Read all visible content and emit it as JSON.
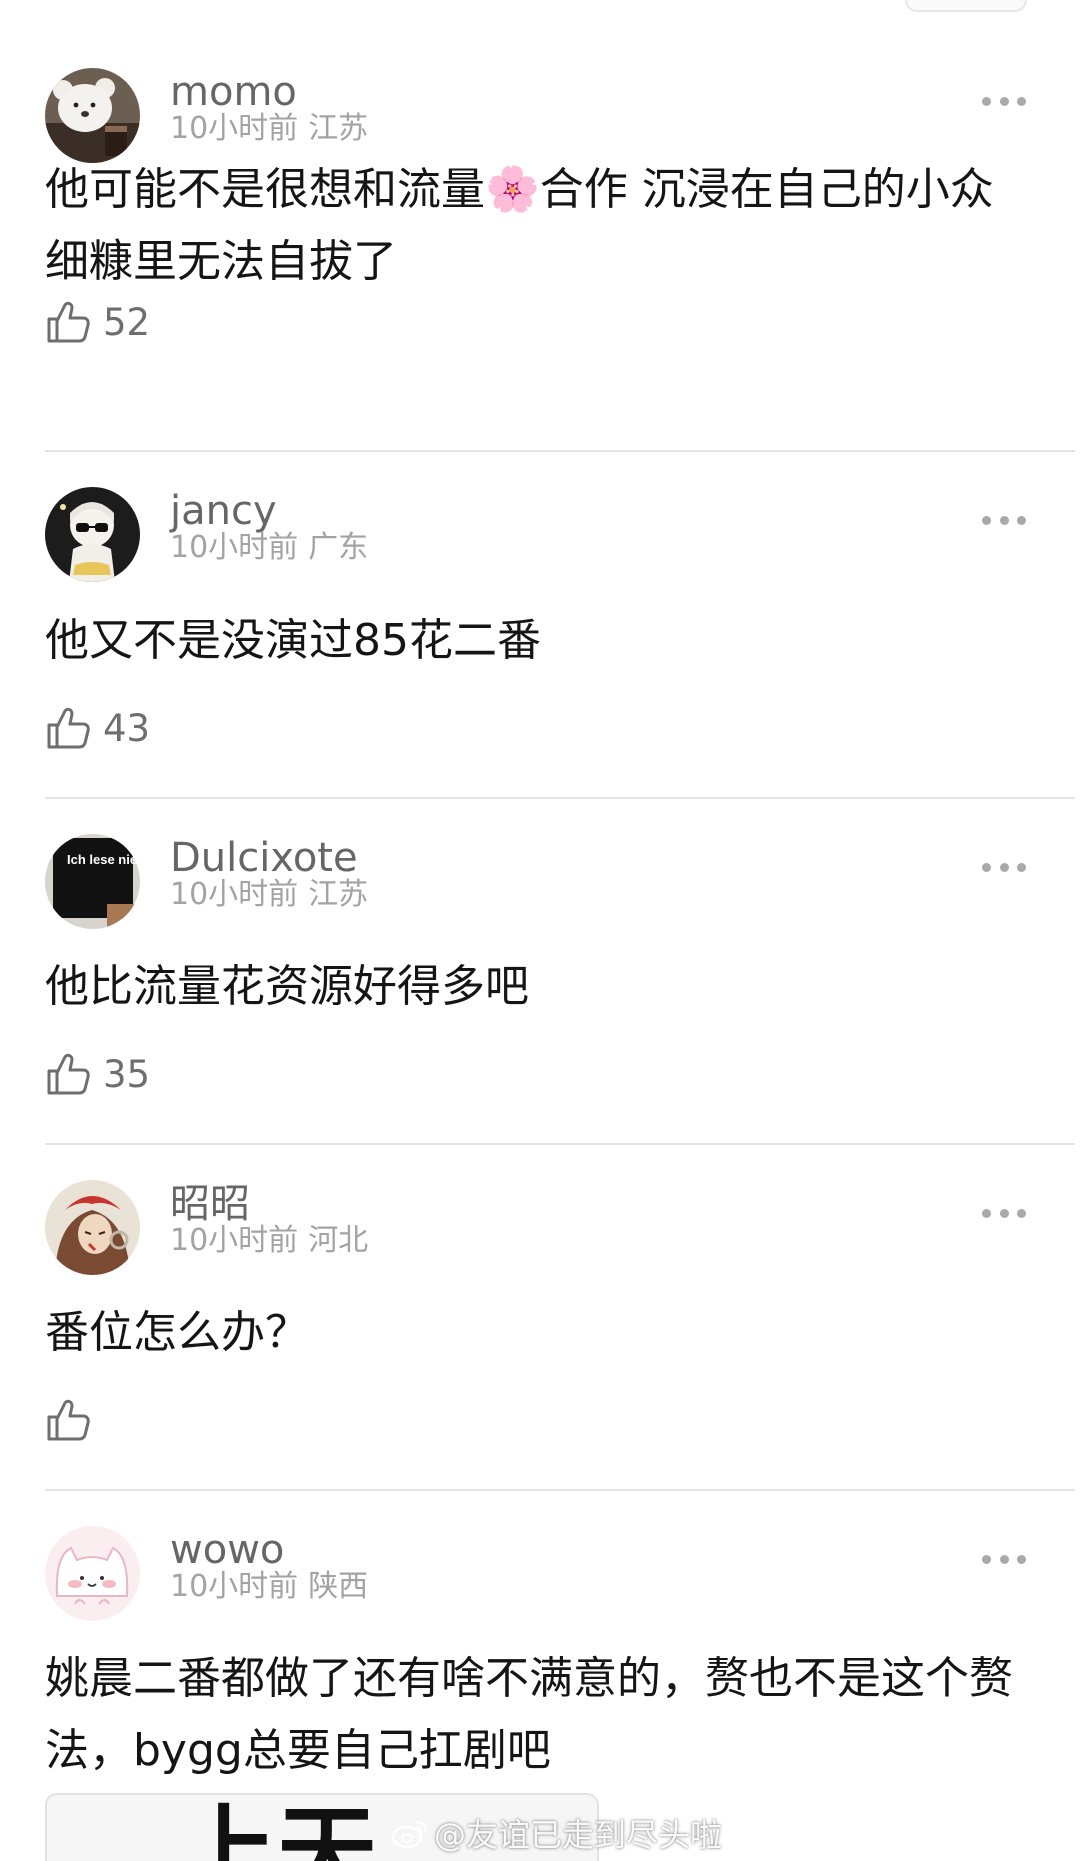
{
  "comments": [
    {
      "username": "momo",
      "time": "10小时前",
      "location": "江苏",
      "text": "他可能不是很想和流量🌸合作 沉浸在自己的小众细糠里无法自拔了",
      "likes": "52",
      "avatar": "white-bear-avatar"
    },
    {
      "username": "jancy",
      "time": "10小时前",
      "location": "广东",
      "text": "他又不是没演过85花二番",
      "likes": "43",
      "avatar": "anime-girl-sunglasses-avatar"
    },
    {
      "username": "Dulcixote",
      "time": "10小时前",
      "location": "江苏",
      "text": "他比流量花资源好得多吧",
      "likes": "35",
      "avatar": "book-cover-avatar",
      "avatar_text": "Ich lese nie.*"
    },
    {
      "username": "昭昭",
      "time": "10小时前",
      "location": "河北",
      "text": "番位怎么办？",
      "likes": "",
      "avatar": "anime-warrior-avatar"
    },
    {
      "username": "wowo",
      "time": "10小时前",
      "location": "陕西",
      "text": "姚晨二番都做了还有啥不满意的，赘也不是这个赘法，bygg总要自己扛剧吧",
      "likes": "",
      "avatar": "pink-cat-avatar"
    }
  ],
  "preview": {
    "text": "上天"
  },
  "watermark": "@友谊已走到尽头啦",
  "icons": {
    "like": "thumbs-up-icon",
    "more": "more-dots-icon",
    "watermark": "weibo-logo-icon"
  }
}
